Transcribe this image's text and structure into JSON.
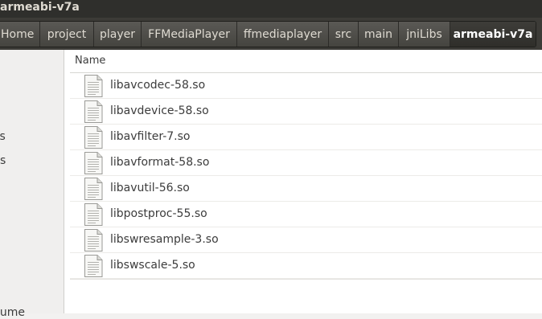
{
  "window": {
    "title": "armeabi-v7a"
  },
  "pathbar": {
    "crumbs": [
      {
        "label": "Home"
      },
      {
        "label": "project"
      },
      {
        "label": "player"
      },
      {
        "label": "FFMediaPlayer"
      },
      {
        "label": "ffmediaplayer"
      },
      {
        "label": "src"
      },
      {
        "label": "main"
      },
      {
        "label": "jniLibs"
      },
      {
        "label": "armeabi-v7a",
        "active": true
      }
    ]
  },
  "sidebar": {
    "items": [
      {
        "label": "ts"
      },
      {
        "label": "s"
      },
      {
        "label": "lume"
      }
    ]
  },
  "file_list": {
    "column_name": "Name",
    "files": [
      {
        "name": "libavcodec-58.so",
        "icon": "text-file-icon"
      },
      {
        "name": "libavdevice-58.so",
        "icon": "text-file-icon"
      },
      {
        "name": "libavfilter-7.so",
        "icon": "text-file-icon"
      },
      {
        "name": "libavformat-58.so",
        "icon": "text-file-icon"
      },
      {
        "name": "libavutil-56.so",
        "icon": "text-file-icon"
      },
      {
        "name": "libpostproc-55.so",
        "icon": "text-file-icon"
      },
      {
        "name": "libswresample-3.so",
        "icon": "text-file-icon"
      },
      {
        "name": "libswscale-5.so",
        "icon": "text-file-icon"
      }
    ]
  }
}
